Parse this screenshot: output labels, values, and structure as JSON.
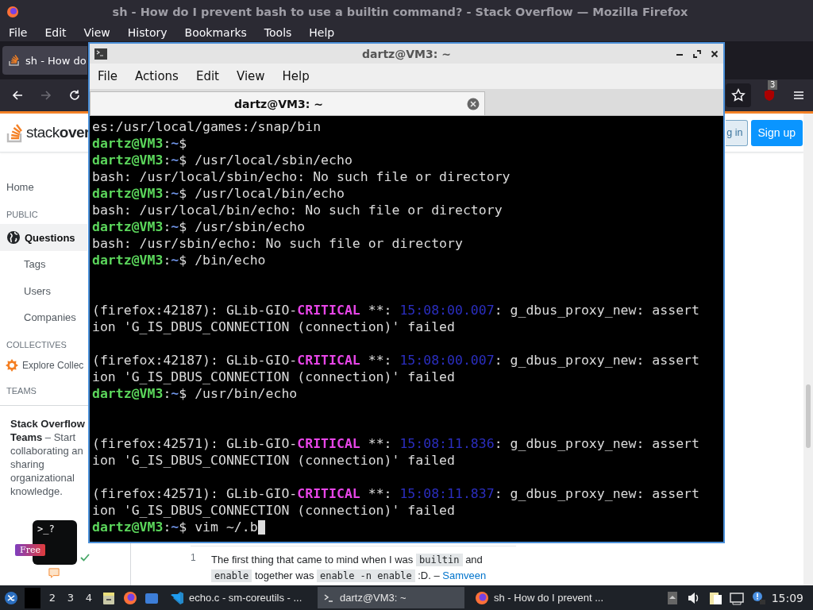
{
  "firefox": {
    "title": "sh - How do I prevent bash to use a builtin command? - Stack Overflow — Mozilla Firefox",
    "menu": [
      "File",
      "Edit",
      "View",
      "History",
      "Bookmarks",
      "Tools",
      "Help"
    ],
    "tabs": [
      {
        "label": "sh - How do",
        "selected": true
      }
    ],
    "nav": {
      "back_disabled": false,
      "forward_disabled": true,
      "extension_badge": "3"
    }
  },
  "page": {
    "logo": "stack**over**",
    "header_buttons": [
      {
        "label": "g in",
        "kind": "secondary"
      },
      {
        "label": "Sign up",
        "kind": "primary"
      }
    ],
    "sidebar": [
      {
        "label": "Home",
        "kind": "link",
        "selected": false
      },
      {
        "label": "PUBLIC",
        "kind": "heading"
      },
      {
        "label": "Questions",
        "kind": "globe",
        "selected": true
      },
      {
        "label": "Tags",
        "kind": "sub",
        "selected": false
      },
      {
        "label": "Users",
        "kind": "sub",
        "selected": false
      },
      {
        "label": "Companies",
        "kind": "sub",
        "selected": false
      },
      {
        "label": "COLLECTIVES",
        "kind": "heading"
      },
      {
        "label": "Explore Collec",
        "kind": "collective",
        "selected": false
      },
      {
        "label": "TEAMS",
        "kind": "heading"
      }
    ],
    "teams": {
      "text": "**Stack Overflow Teams** – Start collaborating an sharing organizational knowledge.",
      "prompt": ">_?",
      "badge": "Free"
    },
    "comment": {
      "score": "1",
      "parts": [
        {
          "text": "The first thing that came to mind when I was ",
          "kind": "text"
        },
        {
          "text": "builtin",
          "kind": "code"
        },
        {
          "text": " and ",
          "kind": "text"
        },
        {
          "text": "enable",
          "kind": "code"
        },
        {
          "text": " together was ",
          "kind": "text"
        },
        {
          "text": "enable -n enable",
          "kind": "code"
        },
        {
          "text": " :D. – ",
          "kind": "text"
        },
        {
          "text": "Samveen",
          "kind": "link"
        }
      ]
    }
  },
  "terminal": {
    "title": "dartz@VM3: ~",
    "menu": [
      "File",
      "Actions",
      "Edit",
      "View",
      "Help"
    ],
    "tabs": [
      {
        "label": "dartz@VM3: ~",
        "selected": true
      }
    ],
    "lines": [
      {
        "kind": "text",
        "segments": [
          {
            "text": "es:/usr/local/games:/snap/bin",
            "kind": "plain"
          }
        ]
      },
      {
        "kind": "text",
        "segments": [
          {
            "text": "dartz@VM3",
            "kind": "user"
          },
          {
            "text": ":",
            "kind": "plain"
          },
          {
            "text": "~",
            "kind": "path"
          },
          {
            "text": "$",
            "kind": "plain"
          }
        ]
      },
      {
        "kind": "text",
        "segments": [
          {
            "text": "dartz@VM3",
            "kind": "user"
          },
          {
            "text": ":",
            "kind": "plain"
          },
          {
            "text": "~",
            "kind": "path"
          },
          {
            "text": "$ /usr/local/sbin/echo",
            "kind": "plain"
          }
        ]
      },
      {
        "kind": "text",
        "segments": [
          {
            "text": "bash: /usr/local/sbin/echo: No such file or directory",
            "kind": "plain"
          }
        ]
      },
      {
        "kind": "text",
        "segments": [
          {
            "text": "dartz@VM3",
            "kind": "user"
          },
          {
            "text": ":",
            "kind": "plain"
          },
          {
            "text": "~",
            "kind": "path"
          },
          {
            "text": "$ /usr/local/bin/echo",
            "kind": "plain"
          }
        ]
      },
      {
        "kind": "text",
        "segments": [
          {
            "text": "bash: /usr/local/bin/echo: No such file or directory",
            "kind": "plain"
          }
        ]
      },
      {
        "kind": "text",
        "segments": [
          {
            "text": "dartz@VM3",
            "kind": "user"
          },
          {
            "text": ":",
            "kind": "plain"
          },
          {
            "text": "~",
            "kind": "path"
          },
          {
            "text": "$ /usr/sbin/echo",
            "kind": "plain"
          }
        ]
      },
      {
        "kind": "text",
        "segments": [
          {
            "text": "bash: /usr/sbin/echo: No such file or directory",
            "kind": "plain"
          }
        ]
      },
      {
        "kind": "text",
        "segments": [
          {
            "text": "dartz@VM3",
            "kind": "user"
          },
          {
            "text": ":",
            "kind": "plain"
          },
          {
            "text": "~",
            "kind": "path"
          },
          {
            "text": "$ /bin/echo",
            "kind": "plain"
          }
        ]
      },
      {
        "kind": "blank"
      },
      {
        "kind": "blank"
      },
      {
        "kind": "text",
        "segments": [
          {
            "text": "(firefox:42187): GLib-GIO-",
            "kind": "plain"
          },
          {
            "text": "CRITICAL",
            "kind": "critical"
          },
          {
            "text": " **: ",
            "kind": "plain"
          },
          {
            "text": "15:08:00.007",
            "kind": "time"
          },
          {
            "text": ": g_dbus_proxy_new: assert",
            "kind": "plain"
          }
        ]
      },
      {
        "kind": "text",
        "segments": [
          {
            "text": "ion 'G_IS_DBUS_CONNECTION (connection)' failed",
            "kind": "plain"
          }
        ]
      },
      {
        "kind": "blank"
      },
      {
        "kind": "text",
        "segments": [
          {
            "text": "(firefox:42187): GLib-GIO-",
            "kind": "plain"
          },
          {
            "text": "CRITICAL",
            "kind": "critical"
          },
          {
            "text": " **: ",
            "kind": "plain"
          },
          {
            "text": "15:08:00.007",
            "kind": "time"
          },
          {
            "text": ": g_dbus_proxy_new: assert",
            "kind": "plain"
          }
        ]
      },
      {
        "kind": "text",
        "segments": [
          {
            "text": "ion 'G_IS_DBUS_CONNECTION (connection)' failed",
            "kind": "plain"
          }
        ]
      },
      {
        "kind": "text",
        "segments": [
          {
            "text": "dartz@VM3",
            "kind": "user"
          },
          {
            "text": ":",
            "kind": "plain"
          },
          {
            "text": "~",
            "kind": "path"
          },
          {
            "text": "$ /usr/bin/echo",
            "kind": "plain"
          }
        ]
      },
      {
        "kind": "blank"
      },
      {
        "kind": "blank"
      },
      {
        "kind": "text",
        "segments": [
          {
            "text": "(firefox:42571): GLib-GIO-",
            "kind": "plain"
          },
          {
            "text": "CRITICAL",
            "kind": "critical"
          },
          {
            "text": " **: ",
            "kind": "plain"
          },
          {
            "text": "15:08:11.836",
            "kind": "time"
          },
          {
            "text": ": g_dbus_proxy_new: assert",
            "kind": "plain"
          }
        ]
      },
      {
        "kind": "text",
        "segments": [
          {
            "text": "ion 'G_IS_DBUS_CONNECTION (connection)' failed",
            "kind": "plain"
          }
        ]
      },
      {
        "kind": "blank"
      },
      {
        "kind": "text",
        "segments": [
          {
            "text": "(firefox:42571): GLib-GIO-",
            "kind": "plain"
          },
          {
            "text": "CRITICAL",
            "kind": "critical"
          },
          {
            "text": " **: ",
            "kind": "plain"
          },
          {
            "text": "15:08:11.837",
            "kind": "time"
          },
          {
            "text": ": g_dbus_proxy_new: assert",
            "kind": "plain"
          }
        ]
      },
      {
        "kind": "text",
        "segments": [
          {
            "text": "ion 'G_IS_DBUS_CONNECTION (connection)' failed",
            "kind": "plain"
          }
        ]
      },
      {
        "kind": "text",
        "cursor": true,
        "segments": [
          {
            "text": "dartz@VM3",
            "kind": "user"
          },
          {
            "text": ":",
            "kind": "plain"
          },
          {
            "text": "~",
            "kind": "path"
          },
          {
            "text": "$ vim ~/.b",
            "kind": "plain"
          }
        ]
      }
    ]
  },
  "taskbar": {
    "workspaces": [
      "2",
      "3",
      "4"
    ],
    "tasks": [
      {
        "label": "echo.c - sm-coreutils - ...",
        "kind": "code",
        "selected": false
      },
      {
        "label": "dartz@VM3: ~",
        "kind": "terminal",
        "selected": true
      },
      {
        "label": "sh - How do I prevent ...",
        "kind": "browser",
        "selected": false
      }
    ],
    "clock": "15:09"
  }
}
